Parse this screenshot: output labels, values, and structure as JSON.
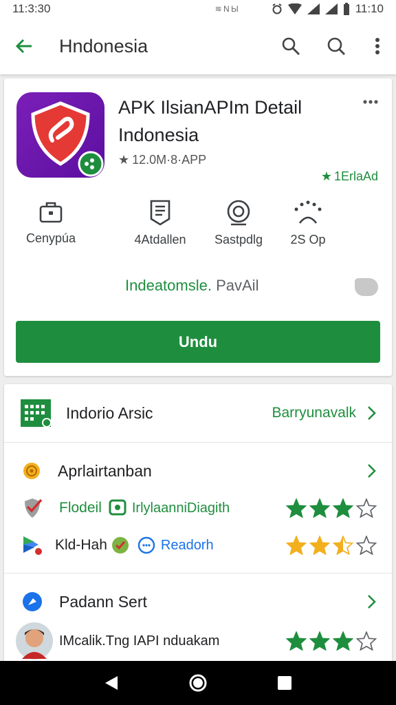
{
  "status_bar": {
    "time": "11:3:30",
    "mid_text": "≋ N Ы",
    "right_time": "11:10"
  },
  "appbar": {
    "title": "Hndonesia"
  },
  "app": {
    "title": "APK IlsianAPIm Detail Indonesia",
    "meta": "12.0M·8·APP",
    "editor_badge": "1ErlaAd"
  },
  "stats": [
    {
      "icon": "briefcase-icon",
      "label": "Cenypúa"
    },
    {
      "icon": "document-icon",
      "label": "4Atdallen"
    },
    {
      "icon": "camera-icon",
      "label": "Sastpdlg"
    },
    {
      "icon": "users-icon",
      "label": "2S Op"
    }
  ],
  "info_row": {
    "green": "Indeatomsle.",
    "gray": "PavAil"
  },
  "install_label": "Undu",
  "section1": {
    "title": "Indorio Arsic",
    "link": "Barryunavalk"
  },
  "reviews_header": "Aprlairtanban",
  "reviews": [
    {
      "name": "Flodeil",
      "tag": "IrlylaanniDiagith",
      "rating": 3,
      "max": 4
    },
    {
      "name": "Kld-Hah",
      "tag": "Readorh",
      "rating": 2.5,
      "max": 4
    }
  ],
  "section3": {
    "title": "Padann Sert"
  },
  "user_review": {
    "text": "IMcalik.Tng IAPI nduakam",
    "rating": 3,
    "max": 4
  },
  "colors": {
    "green": "#1e8e3e",
    "gold": "#f2b01e",
    "purple": "#6a16ad"
  }
}
